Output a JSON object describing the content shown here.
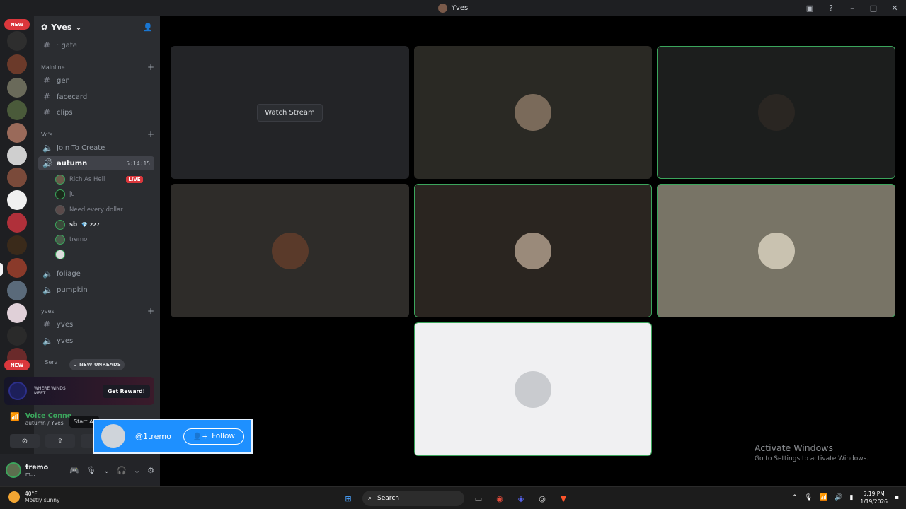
{
  "window": {
    "title": "Yves"
  },
  "rail": {
    "new_badge_top": "NEW",
    "new_badge_bottom": "NEW"
  },
  "guild": {
    "name": "Yves"
  },
  "channels": {
    "gate": "· gate",
    "cat_mainline": "Mainline",
    "gen": "gen",
    "facecard": "facecard",
    "clips": "clips",
    "cat_vcs": "Vc's",
    "join_to_create": "Join To Create",
    "autumn": "autumn",
    "autumn_timer": "5:14:15",
    "foliage": "foliage",
    "pumpkin": "pumpkin",
    "cat_yves": "yves",
    "yves_text": "yves",
    "yves_voice": "yves",
    "cat_server": "| Serv"
  },
  "voice_users": [
    {
      "name": "Rich As Hell",
      "badge": "LIVE"
    },
    {
      "name": "ju"
    },
    {
      "name": "Need every dollar"
    },
    {
      "name": "sb",
      "extra": "227"
    },
    {
      "name": "tremo"
    },
    {
      "name": ""
    }
  ],
  "new_unreads": "NEW UNREADS",
  "promo": {
    "brand": "WHERE WINDS MEET",
    "button": "Get Reward!"
  },
  "voice_panel": {
    "status": "Voice Conne",
    "sub": "autumn / Yves",
    "tooltip": "Start A"
  },
  "user_panel": {
    "name": "tremo",
    "sub": "m..."
  },
  "grid": {
    "watch_stream": "Watch Stream"
  },
  "follow_popup": {
    "handle": "@1tremo",
    "button": "Follow"
  },
  "activate": {
    "line1": "Activate Windows",
    "line2": "Go to Settings to activate Windows."
  },
  "taskbar": {
    "temp": "40°F",
    "condition": "Mostly sunny",
    "search": "Search",
    "time": "5:19 PM",
    "date": "1/19/2026"
  },
  "colors": {
    "accent_green": "#3ba55c",
    "live_red": "#da373c",
    "follow_blue": "#1e90ff"
  }
}
